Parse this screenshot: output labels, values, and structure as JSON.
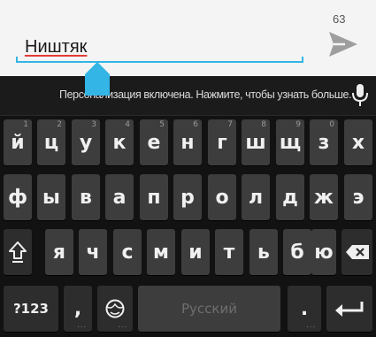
{
  "compose": {
    "typed_text": "Ништяк",
    "char_counter": "63"
  },
  "suggestion_strip": {
    "text": "Персонализация включена. Нажмите, чтобы узнать больше."
  },
  "keyboard": {
    "row1": [
      {
        "label": "й",
        "hint": "1"
      },
      {
        "label": "ц",
        "hint": "2"
      },
      {
        "label": "у",
        "hint": "3"
      },
      {
        "label": "к",
        "hint": "4"
      },
      {
        "label": "е",
        "hint": "5"
      },
      {
        "label": "н",
        "hint": "6"
      },
      {
        "label": "г",
        "hint": "7"
      },
      {
        "label": "ш",
        "hint": "8"
      },
      {
        "label": "щ",
        "hint": "9"
      },
      {
        "label": "з",
        "hint": "0"
      },
      {
        "label": "х",
        "hint": ""
      }
    ],
    "row2": [
      "ф",
      "ы",
      "в",
      "а",
      "п",
      "р",
      "о",
      "л",
      "д",
      "ж",
      "э"
    ],
    "row3": [
      "я",
      "ч",
      "с",
      "м",
      "и",
      "т",
      "ь",
      "б",
      "ю"
    ],
    "symbols_label": "?123",
    "comma_label": ",",
    "space_label": "Русский",
    "period_label": "."
  },
  "colors": {
    "accent": "#33b5e5",
    "key_bg": "#3d3d3d",
    "keyboard_bg": "#121212"
  },
  "icons": [
    "send-icon",
    "mic-icon",
    "shift-icon",
    "backspace-icon",
    "emoji-icon",
    "enter-icon",
    "cursor-handle"
  ]
}
